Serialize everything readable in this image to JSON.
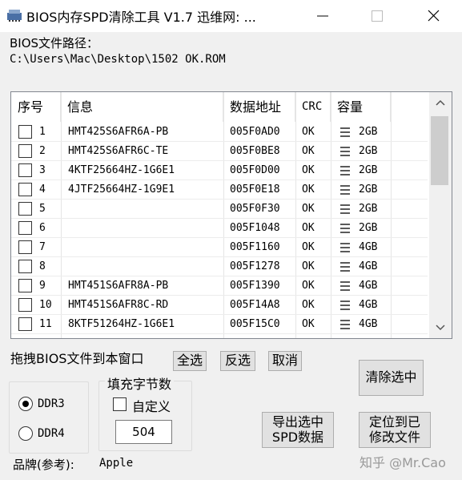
{
  "window": {
    "title": "BIOS内存SPD清除工具 V1.7    迅维网: ..."
  },
  "path": {
    "label": "BIOS文件路径：",
    "value": "C:\\Users\\Mac\\Desktop\\1502 OK.ROM"
  },
  "table": {
    "columns": [
      "序号",
      "信息",
      "数据地址",
      "CRC",
      "容量"
    ],
    "rows": [
      {
        "no": "1",
        "info": "HMT425S6AFR6A-PB",
        "addr": "005F0AD0",
        "crc": "OK",
        "cap": "2GB"
      },
      {
        "no": "2",
        "info": "HMT425S6AFR6C-TE",
        "addr": "005F0BE8",
        "crc": "OK",
        "cap": "2GB"
      },
      {
        "no": "3",
        "info": "4KTF25664HZ-1G6E1",
        "addr": "005F0D00",
        "crc": "OK",
        "cap": "2GB"
      },
      {
        "no": "4",
        "info": "4JTF25664HZ-1G9E1",
        "addr": "005F0E18",
        "crc": "OK",
        "cap": "2GB"
      },
      {
        "no": "5",
        "info": "",
        "addr": "005F0F30",
        "crc": "OK",
        "cap": "2GB"
      },
      {
        "no": "6",
        "info": "",
        "addr": "005F1048",
        "crc": "OK",
        "cap": "2GB"
      },
      {
        "no": "7",
        "info": "",
        "addr": "005F1160",
        "crc": "OK",
        "cap": "4GB"
      },
      {
        "no": "8",
        "info": "",
        "addr": "005F1278",
        "crc": "OK",
        "cap": "4GB"
      },
      {
        "no": "9",
        "info": "HMT451S6AFR8A-PB",
        "addr": "005F1390",
        "crc": "OK",
        "cap": "4GB"
      },
      {
        "no": "10",
        "info": "HMT451S6AFR8C-RD",
        "addr": "005F14A8",
        "crc": "OK",
        "cap": "4GB"
      },
      {
        "no": "11",
        "info": "8KTF51264HZ-1G6E1",
        "addr": "005F15C0",
        "crc": "OK",
        "cap": "4GB"
      }
    ]
  },
  "drag_hint": "拖拽BIOS文件到本窗口",
  "buttons": {
    "select_all": "全选",
    "invert": "反选",
    "cancel": "取消",
    "clear_selected": "清除选中",
    "export_line1": "导出选中",
    "export_line2": "SPD数据",
    "locate_line1": "定位到已",
    "locate_line2": "修改文件"
  },
  "ddr": {
    "ddr3": "DDR3",
    "ddr4": "DDR4",
    "selected": "DDR3"
  },
  "fill": {
    "legend": "填充字节数",
    "custom_label": "自定义",
    "value": "504"
  },
  "brand": {
    "label": "品牌(参考):",
    "value": "Apple"
  },
  "watermark": "知乎 @Mr.Cao"
}
